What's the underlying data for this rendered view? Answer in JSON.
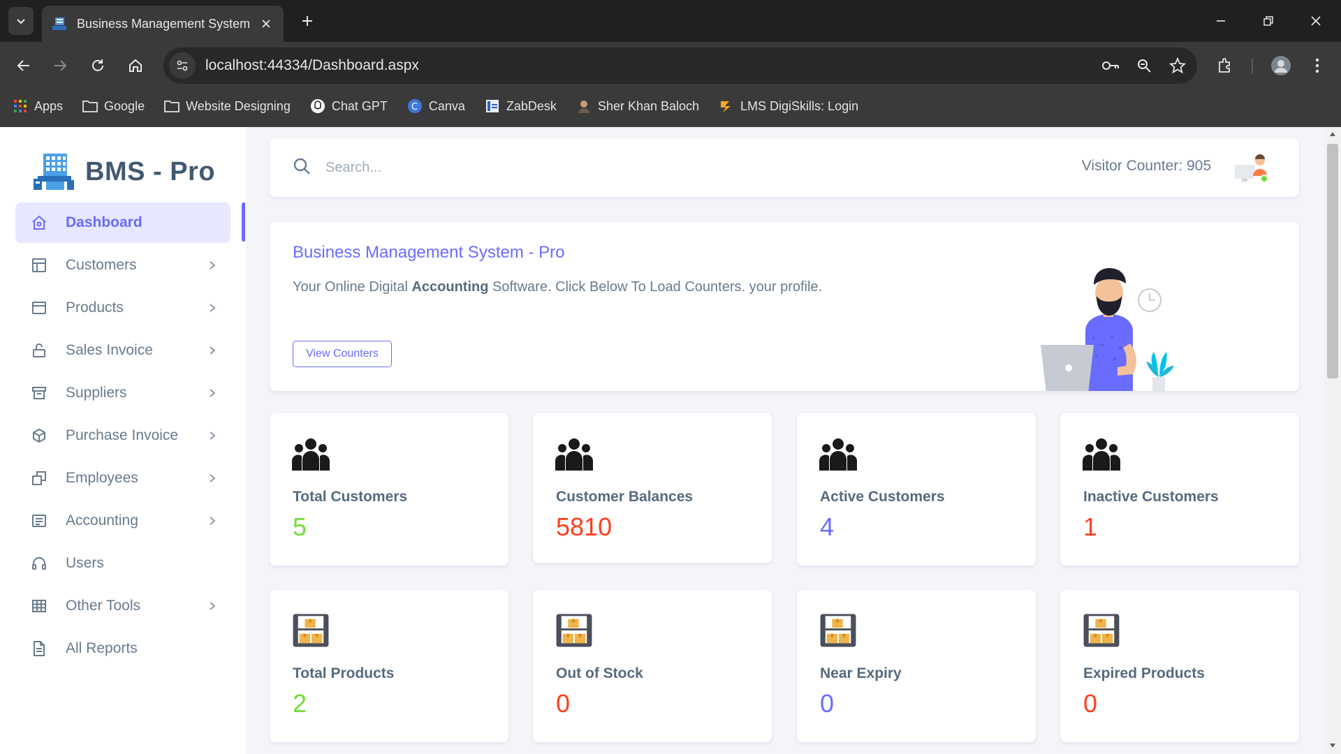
{
  "browser": {
    "tab_title": "Business Management System",
    "url": "localhost:44334/Dashboard.aspx",
    "bookmarks": [
      {
        "label": "Apps",
        "icon": "apps-grid-icon"
      },
      {
        "label": "Google",
        "icon": "folder-icon"
      },
      {
        "label": "Website Designing",
        "icon": "folder-icon"
      },
      {
        "label": "Chat GPT",
        "icon": "chatgpt-icon"
      },
      {
        "label": "Canva",
        "icon": "canva-icon"
      },
      {
        "label": "ZabDesk",
        "icon": "zabdesk-icon"
      },
      {
        "label": "Sher Khan Baloch",
        "icon": "profile-icon"
      },
      {
        "label": "LMS DigiSkills: Login",
        "icon": "digiskills-icon"
      }
    ]
  },
  "sidebar": {
    "brand": "BMS - Pro",
    "items": [
      {
        "label": "Dashboard",
        "icon": "home-icon",
        "active": true,
        "has_submenu": false
      },
      {
        "label": "Customers",
        "icon": "layout-icon",
        "has_submenu": true
      },
      {
        "label": "Products",
        "icon": "window-icon",
        "has_submenu": true
      },
      {
        "label": "Sales Invoice",
        "icon": "lock-open-icon",
        "has_submenu": true
      },
      {
        "label": "Suppliers",
        "icon": "archive-icon",
        "has_submenu": true
      },
      {
        "label": "Purchase Invoice",
        "icon": "cube-icon",
        "has_submenu": true
      },
      {
        "label": "Employees",
        "icon": "copy-icon",
        "has_submenu": true
      },
      {
        "label": "Accounting",
        "icon": "list-detail-icon",
        "has_submenu": true
      },
      {
        "label": "Users",
        "icon": "headphones-icon",
        "has_submenu": false
      },
      {
        "label": "Other Tools",
        "icon": "grid-icon",
        "has_submenu": true
      },
      {
        "label": "All Reports",
        "icon": "file-icon",
        "has_submenu": false
      }
    ]
  },
  "topnav": {
    "search_placeholder": "Search...",
    "visitor_counter": "Visitor Counter: 905"
  },
  "welcome": {
    "title": "Business Management System - Pro",
    "desc_before": "Your Online Digital ",
    "desc_bold": "Accounting",
    "desc_after": " Software. Click Below To Load Counters. your profile.",
    "button": "View Counters"
  },
  "stats": [
    {
      "label": "Total Customers",
      "value": "5",
      "color": "#71dd37",
      "icon": "users-icon"
    },
    {
      "label": "Customer Balances",
      "value": "5810",
      "color": "#ff3e1d",
      "icon": "users-icon"
    },
    {
      "label": "Active Customers",
      "value": "4",
      "color": "#696cff",
      "icon": "users-icon"
    },
    {
      "label": "Inactive Customers",
      "value": "1",
      "color": "#ff3e1d",
      "icon": "users-icon"
    },
    {
      "label": "Total Products",
      "value": "2",
      "color": "#71dd37",
      "icon": "warehouse-boxes-icon"
    },
    {
      "label": "Out of Stock",
      "value": "0",
      "color": "#ff3e1d",
      "icon": "warehouse-boxes-icon"
    },
    {
      "label": "Near Expiry",
      "value": "0",
      "color": "#696cff",
      "icon": "warehouse-boxes-icon"
    },
    {
      "label": "Expired Products",
      "value": "0",
      "color": "#ff3e1d",
      "icon": "warehouse-boxes-icon"
    }
  ],
  "colors": {
    "primary": "#696cff",
    "success": "#71dd37",
    "danger": "#ff3e1d",
    "heading": "#435971",
    "body_bg": "#f4f5f9"
  }
}
